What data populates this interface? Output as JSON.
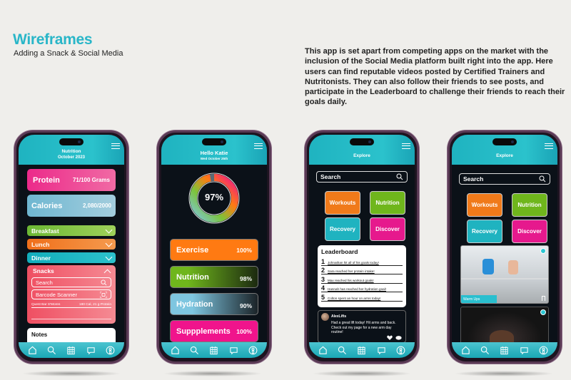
{
  "header": {
    "title": "Wireframes",
    "subtitle": "Adding a Snack & Social Media",
    "description": "This app is set apart from competing apps on the market with the inclusion of the Social Media platform built right into the app. Here users can find reputable videos posted by Certified Trainers and Nutritonists. They can also follow their friends to see posts, and participate in the Leaderboard to challenge their friends to reach their goals daily."
  },
  "colors": {
    "brand": "#29b6c8",
    "protein": "#ee3f8f",
    "calories": "#8ac3d9",
    "breakfast": "#7cbf3a",
    "lunch": "#f07a23",
    "dinner": "#1fb3c0",
    "snacks": "#f0606b",
    "exercise": "#ff7a12",
    "nutrition": "#6fb61c",
    "hydration": "#7ec6e0",
    "supplements": "#f0148c",
    "discover": "#e6198d",
    "recovery": "#1fb3c0"
  },
  "nav_icons": [
    "home-icon",
    "search-icon",
    "calendar-icon",
    "chat-icon",
    "profile-icon"
  ],
  "screen1": {
    "title": "Nutrition",
    "date": "October 2023",
    "protein": {
      "label": "Protein",
      "value": "71/100 Grams"
    },
    "calories": {
      "label": "Calories",
      "value": "2,080/2000"
    },
    "meals": [
      {
        "label": "Breakfast"
      },
      {
        "label": "Lunch"
      },
      {
        "label": "Dinner"
      }
    ],
    "snacks": {
      "label": "Snacks",
      "search_placeholder": "Search",
      "barcode_label": "Barcode Scanner",
      "item_name": "Quest Bar S'Mores",
      "item_info": "180 Cal, 21 g Protein"
    },
    "notes_label": "Notes"
  },
  "screen2": {
    "title": "Hello Katie",
    "date": "Wed October 25th",
    "overall_percent": "97%",
    "overall_value": 0.97,
    "stats": [
      {
        "label": "Exercise",
        "value": "100%"
      },
      {
        "label": "Nutrition",
        "value": "98%"
      },
      {
        "label": "Hydration",
        "value": "90%"
      },
      {
        "label": "Suppplements",
        "value": "100%"
      }
    ]
  },
  "screen3": {
    "title": "Explore",
    "search_placeholder": "Search",
    "tiles": [
      "Workouts",
      "Nutrition",
      "Recovery",
      "Discover"
    ],
    "leaderboard": {
      "title": "Leaderboard",
      "entries": [
        {
          "rank": "1",
          "text": "Johnathan hit all of his goals today!"
        },
        {
          "rank": "2",
          "text": "Sara reached her protein intake!"
        },
        {
          "rank": "3",
          "text": "Max reached his workout goals!"
        },
        {
          "rank": "4",
          "text": "Hannah has reached her hydration goal!"
        },
        {
          "rank": "5",
          "text": "Colton spent an hour on arms today!"
        }
      ]
    },
    "post": {
      "author": "AlexLifts",
      "text": "Had a great lift today! Hit arms and back. Check out my page for a new arm day routine!"
    }
  },
  "screen4": {
    "title": "Explore",
    "search_placeholder": "Search",
    "tiles": [
      "Workouts",
      "Nutrition",
      "Recovery",
      "Discover"
    ],
    "video1_label": "Warm Ups"
  }
}
